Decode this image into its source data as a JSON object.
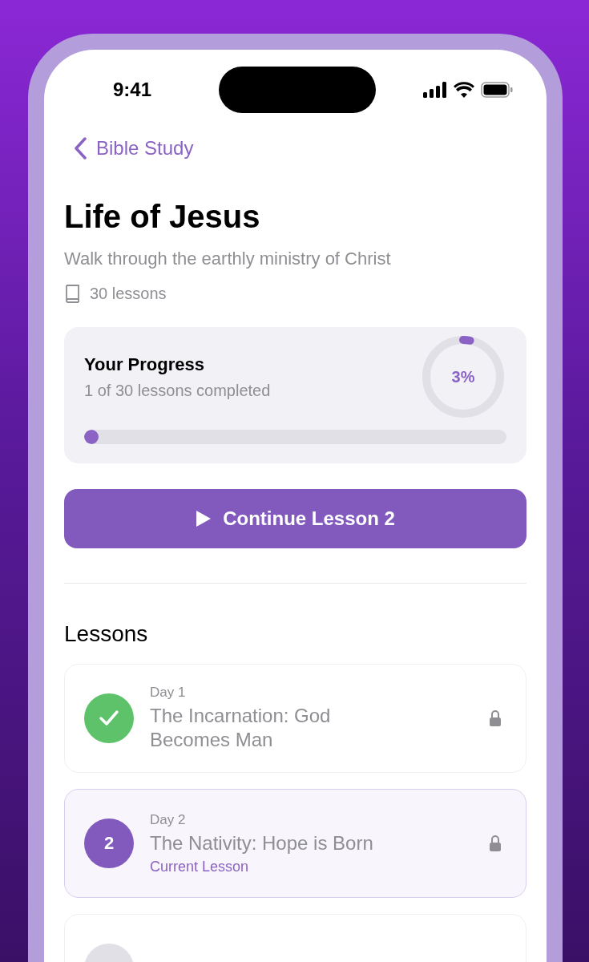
{
  "status_bar": {
    "time": "9:41"
  },
  "nav": {
    "back_label": "Bible Study"
  },
  "course": {
    "title": "Life of Jesus",
    "subtitle": "Walk through the earthly ministry of Christ",
    "lesson_count": "30 lessons"
  },
  "progress": {
    "title": "Your Progress",
    "subtitle": "1 of 30 lessons completed",
    "percent": "3%",
    "level": 0.03
  },
  "continue_button": {
    "label": "Continue Lesson 2"
  },
  "lessons_header": "Lessons",
  "lessons": [
    {
      "kind": "completed",
      "day": "Day 1",
      "title": "The Incarnation: God Becomes Man",
      "locked": true
    },
    {
      "kind": "current",
      "number": "2",
      "day": "Day 2",
      "title": "The Nativity: Hope is Born",
      "badge": "Current Lesson",
      "locked": true
    },
    {
      "kind": "upcoming"
    }
  ]
}
